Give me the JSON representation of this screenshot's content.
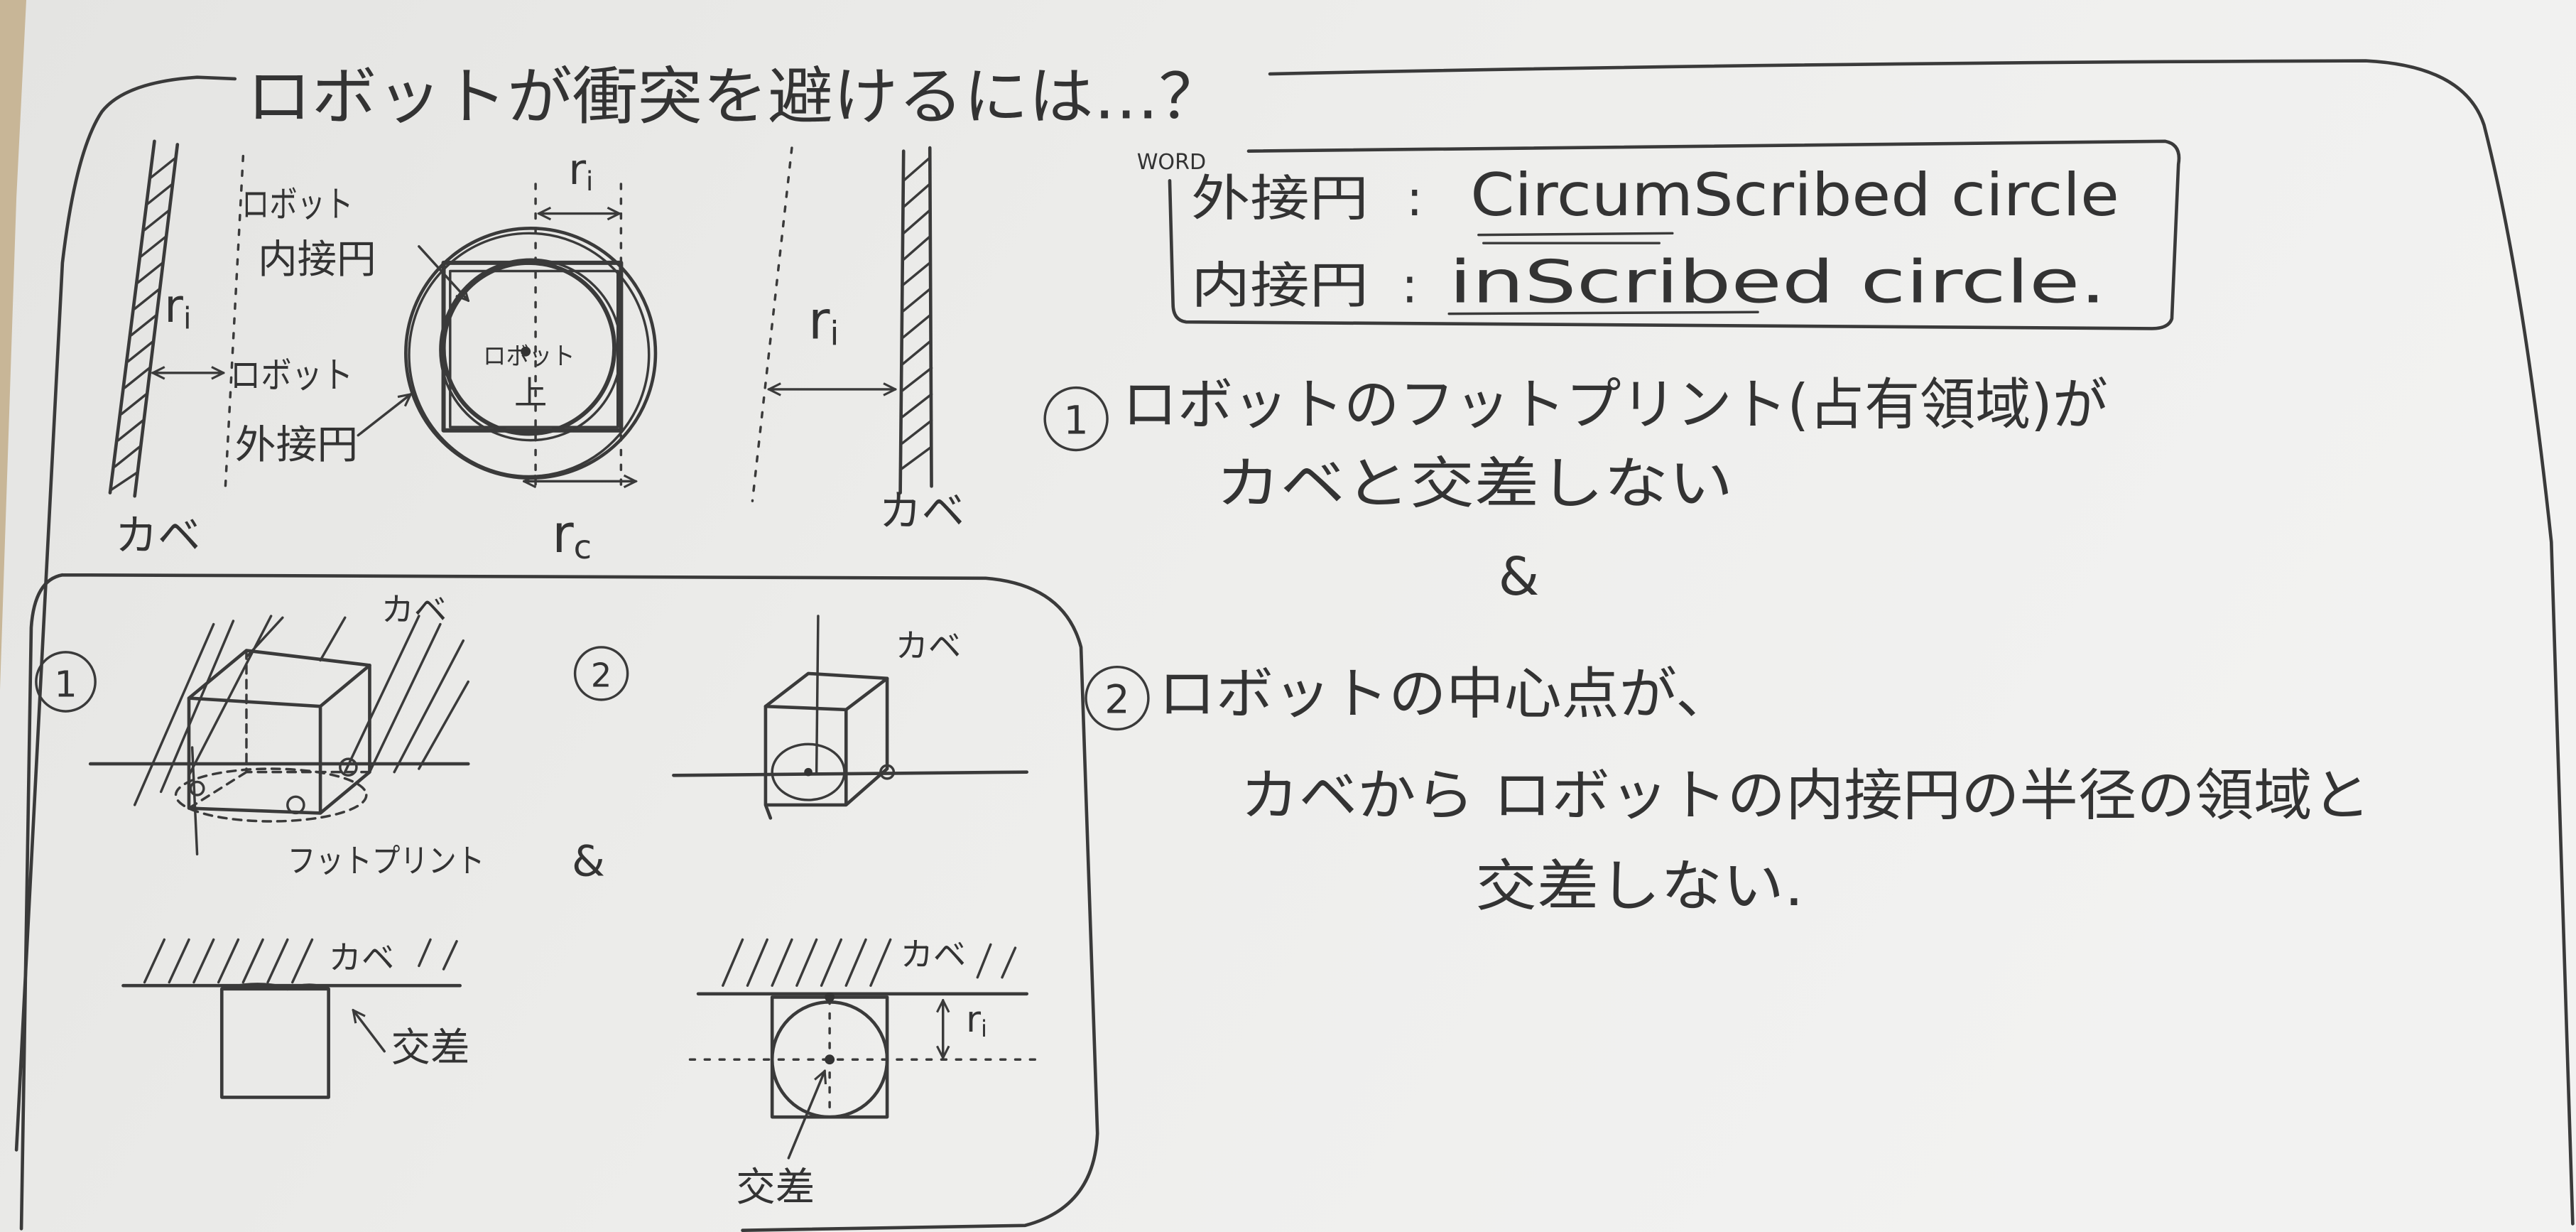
{
  "colors": {
    "ink": "#333333",
    "paper": "#ececea",
    "wood": "#c8b697"
  },
  "title": "ロボットが衝突を避けるには…？",
  "top_diagram": {
    "left_wall_label": "カベ",
    "right_wall_label": "カベ",
    "left_gap_label": {
      "base": "r",
      "sub": "i"
    },
    "inscribed_label": [
      "ロボット",
      "内接円"
    ],
    "circumscribed_label": [
      "ロボット",
      "外接円"
    ],
    "robot_label": [
      "ロボット",
      "上"
    ],
    "top_radius_label": {
      "base": "r",
      "sub": "i"
    },
    "bottom_radius_label": {
      "base": "r",
      "sub": "c"
    },
    "right_gap_label": {
      "base": "r",
      "sub": "i"
    }
  },
  "word_box": {
    "heading": "WORD",
    "entries": [
      {
        "term": "外接円",
        "sep": ":",
        "english": "CircumScribed circle"
      },
      {
        "term": "内接円",
        "sep": ":",
        "english": "inScribed circle."
      }
    ]
  },
  "conditions": {
    "one": {
      "marker": "1",
      "lines": [
        "ロボットのフットプリント(占有領域)が",
        "カベと交差しない"
      ]
    },
    "and": "&",
    "two": {
      "marker": "2",
      "lines": [
        "ロボットの中心点が、",
        "カベから ロボットの内接円の半径の領域と",
        "交差しない."
      ]
    }
  },
  "bottom_box": {
    "panel1": {
      "marker": "1",
      "wall_label": "カベ",
      "footprint_label": "フットプリント"
    },
    "and": "&",
    "panel2": {
      "marker": "2",
      "wall_label": "カベ"
    },
    "panel3": {
      "wall_label": "カベ",
      "cross_label": "交差"
    },
    "panel4": {
      "wall_label": "カベ",
      "radius_label": {
        "base": "r",
        "sub": "i"
      },
      "cross_label": "交差"
    }
  }
}
